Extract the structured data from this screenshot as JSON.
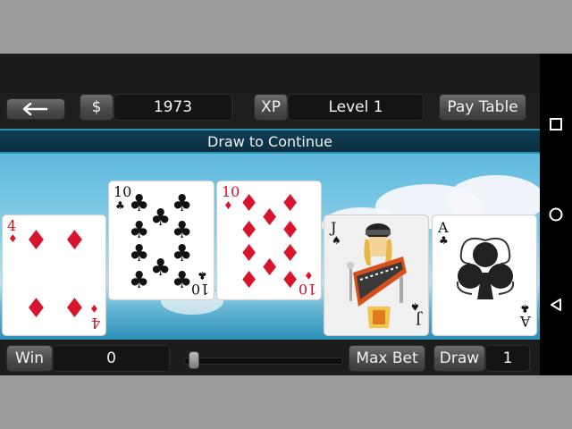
{
  "topbar": {
    "back_icon": "left-arrow-icon",
    "currency_label": "$",
    "credits": "1973",
    "xp_label": "XP",
    "level": "Level 1",
    "paytable_label": "Pay Table"
  },
  "status": {
    "message": "Draw to Continue"
  },
  "hand": [
    {
      "rank": "4",
      "suit": "diamonds",
      "color": "#d9142d"
    },
    {
      "rank": "10",
      "suit": "clubs",
      "color": "#111111"
    },
    {
      "rank": "10",
      "suit": "diamonds",
      "color": "#d9142d"
    },
    {
      "rank": "J",
      "suit": "spades",
      "color": "#111111"
    },
    {
      "rank": "A",
      "suit": "clubs",
      "color": "#111111"
    }
  ],
  "bottombar": {
    "win_label": "Win",
    "win_value": "0",
    "maxbet_label": "Max Bet",
    "draw_label": "Draw",
    "bet_value": "1",
    "bet_level": 0.02
  },
  "system_nav": [
    "square-icon",
    "circle-icon",
    "triangle-back-icon"
  ]
}
